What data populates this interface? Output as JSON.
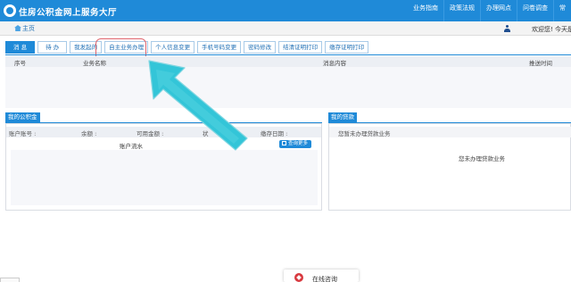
{
  "header": {
    "site_title": "住房公积金网上服务大厅",
    "nav": [
      "业务指南",
      "政策法规",
      "办理网点",
      "问卷调查",
      "常"
    ]
  },
  "subbar": {
    "home_label": "主页",
    "welcome": "欢迎您! 今天是"
  },
  "tabs": [
    "消 息",
    "待 办",
    "我发起的",
    "自主业务办理",
    "个人信息变更",
    "手机号码变更",
    "密码修改",
    "结清证明打印",
    "缴存证明打印"
  ],
  "messages": {
    "columns": [
      "序号",
      "业务名称",
      "消息内容",
      "推送时间"
    ]
  },
  "account_panel": {
    "title": "我的公积金",
    "fields": [
      "账户账号 :",
      "余额 :",
      "可用金额 :",
      "状",
      "缴存日期 :"
    ],
    "flow_title": "账户流水",
    "query_button": "查询更多"
  },
  "loan_panel": {
    "title": "我的贷款",
    "header_text": "您暂未办理贷款业务",
    "empty_text": "您未办理贷款业务"
  },
  "consult": {
    "label": "在线咨询"
  },
  "colors": {
    "primary": "#1f8ad8",
    "highlight_ring": "#e0666e",
    "arrow": "#33c5d8"
  }
}
